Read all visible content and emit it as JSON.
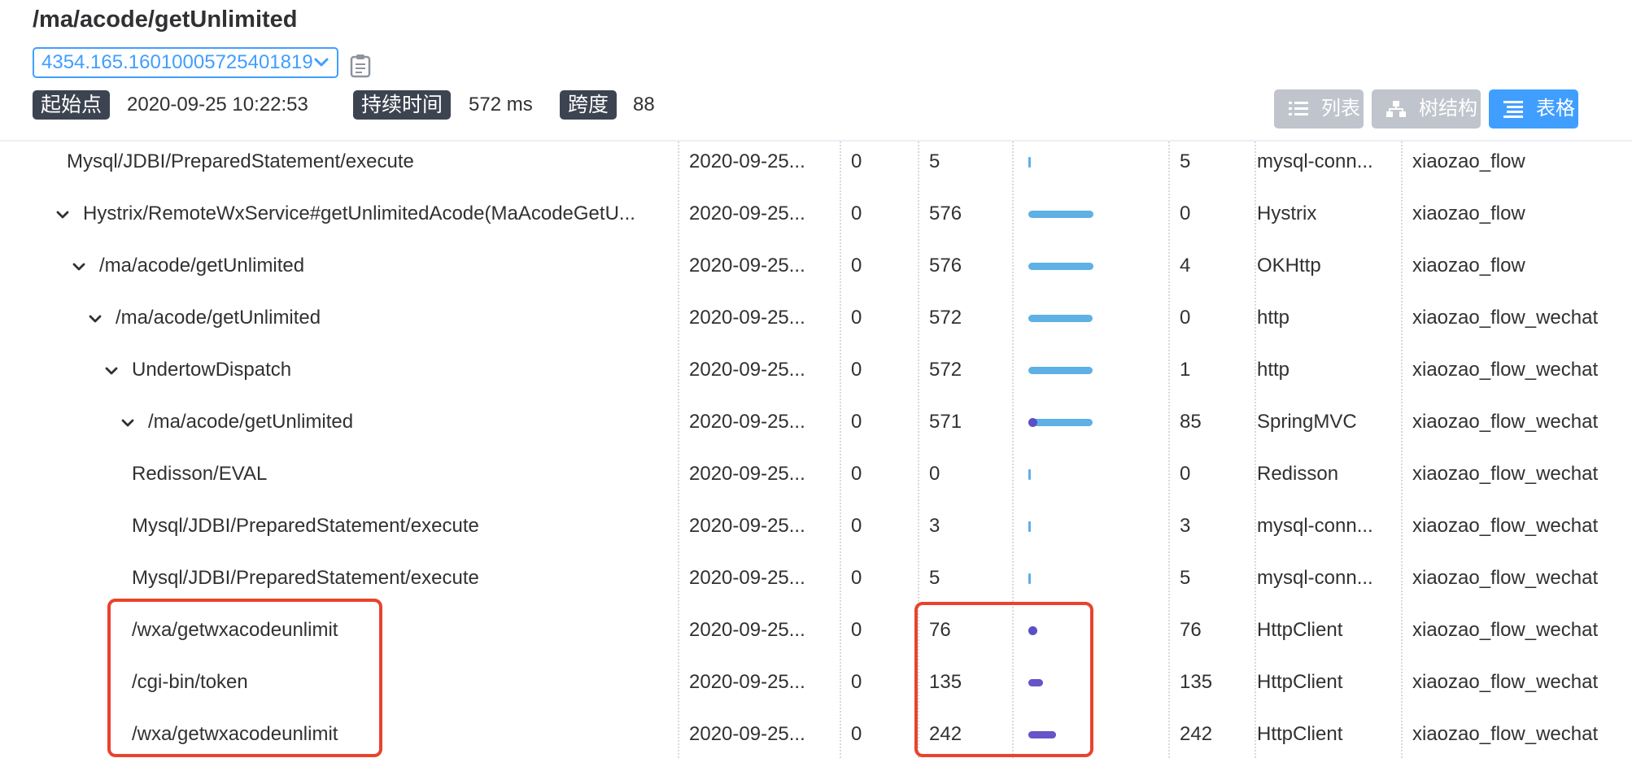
{
  "page": {
    "title": "/ma/acode/getUnlimited",
    "trace_id": "4354.165.16010005725401819"
  },
  "meta": {
    "start_label": "起始点",
    "start_value": "2020-09-25 10:22:53",
    "duration_label": "持续时间",
    "duration_value": "572 ms",
    "span_label": "跨度",
    "span_value": "88"
  },
  "views": {
    "list_label": "列表",
    "tree_label": "树结构",
    "table_label": "表格"
  },
  "colors": {
    "accent": "#409eff",
    "bar_blue": "#5eb0e5",
    "bar_self": "#6654c8",
    "highlight": "#e9432d"
  },
  "rows": [
    {
      "name": "Mysql/JDBI/PreparedStatement/execute",
      "expanded": false,
      "time": "2020-09-25...",
      "v1": "0",
      "duration": "5",
      "bar_total": 0.01,
      "bar_self": 0.0,
      "self": "5",
      "component": "mysql-conn...",
      "service": "xiaozao_flow"
    },
    {
      "name": "Hystrix/RemoteWxService#getUnlimitedAcode(MaAcodeGetU...",
      "expanded": true,
      "time": "2020-09-25...",
      "v1": "0",
      "duration": "576",
      "bar_total": 1.0,
      "bar_self": 0.0,
      "self": "0",
      "component": "Hystrix",
      "service": "xiaozao_flow"
    },
    {
      "name": "/ma/acode/getUnlimited",
      "expanded": true,
      "time": "2020-09-25...",
      "v1": "0",
      "duration": "576",
      "bar_total": 1.0,
      "bar_self": 0.0,
      "self": "4",
      "component": "OKHttp",
      "service": "xiaozao_flow"
    },
    {
      "name": "/ma/acode/getUnlimited",
      "expanded": true,
      "time": "2020-09-25...",
      "v1": "0",
      "duration": "572",
      "bar_total": 0.99,
      "bar_self": 0.0,
      "self": "0",
      "component": "http",
      "service": "xiaozao_flow_wechat"
    },
    {
      "name": "UndertowDispatch",
      "expanded": true,
      "time": "2020-09-25...",
      "v1": "0",
      "duration": "572",
      "bar_total": 0.99,
      "bar_self": 0.0,
      "self": "1",
      "component": "http",
      "service": "xiaozao_flow_wechat"
    },
    {
      "name": "/ma/acode/getUnlimited",
      "expanded": true,
      "time": "2020-09-25...",
      "v1": "0",
      "duration": "571",
      "bar_total": 0.99,
      "bar_self": 0.15,
      "self": "85",
      "component": "SpringMVC",
      "service": "xiaozao_flow_wechat"
    },
    {
      "name": "Redisson/EVAL",
      "expanded": false,
      "time": "2020-09-25...",
      "v1": "0",
      "duration": "0",
      "bar_total": 0.0,
      "bar_self": 0.0,
      "self": "0",
      "component": "Redisson",
      "service": "xiaozao_flow_wechat"
    },
    {
      "name": "Mysql/JDBI/PreparedStatement/execute",
      "expanded": false,
      "time": "2020-09-25...",
      "v1": "0",
      "duration": "3",
      "bar_total": 0.01,
      "bar_self": 0.0,
      "self": "3",
      "component": "mysql-conn...",
      "service": "xiaozao_flow_wechat"
    },
    {
      "name": "Mysql/JDBI/PreparedStatement/execute",
      "expanded": false,
      "time": "2020-09-25...",
      "v1": "0",
      "duration": "5",
      "bar_total": 0.01,
      "bar_self": 0.0,
      "self": "5",
      "component": "mysql-conn...",
      "service": "xiaozao_flow_wechat"
    },
    {
      "name": "/wxa/getwxacodeunlimit",
      "expanded": false,
      "time": "2020-09-25...",
      "v1": "0",
      "duration": "76",
      "bar_total": 0.13,
      "bar_self": 0.13,
      "self": "76",
      "component": "HttpClient",
      "service": "xiaozao_flow_wechat"
    },
    {
      "name": "/cgi-bin/token",
      "expanded": false,
      "time": "2020-09-25...",
      "v1": "0",
      "duration": "135",
      "bar_total": 0.23,
      "bar_self": 0.23,
      "self": "135",
      "component": "HttpClient",
      "service": "xiaozao_flow_wechat"
    },
    {
      "name": "/wxa/getwxacodeunlimit",
      "expanded": false,
      "time": "2020-09-25...",
      "v1": "0",
      "duration": "242",
      "bar_total": 0.42,
      "bar_self": 0.42,
      "self": "242",
      "component": "HttpClient",
      "service": "xiaozao_flow_wechat"
    }
  ]
}
